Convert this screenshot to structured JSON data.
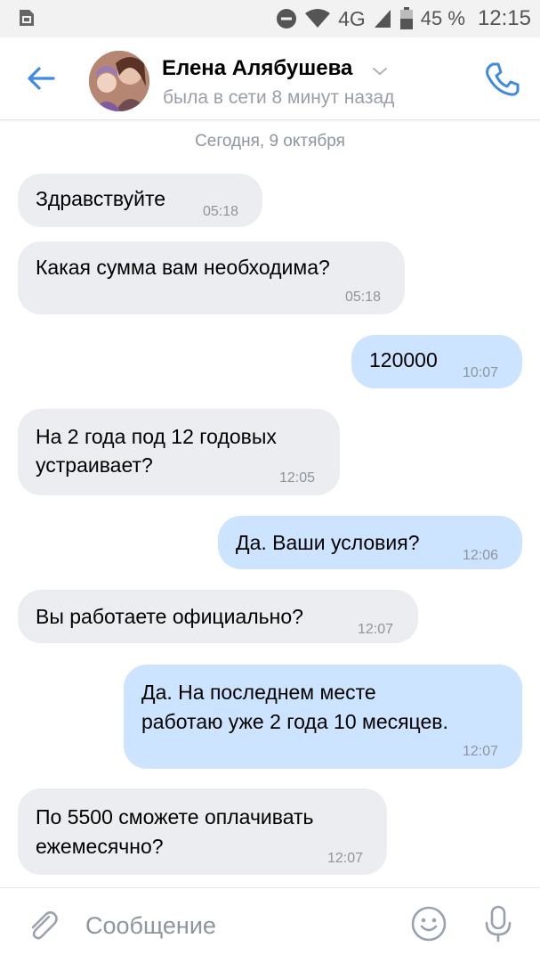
{
  "status_bar": {
    "network": "4G",
    "battery": "45 %",
    "time": "12:15",
    "icons": [
      "sim-card-icon",
      "do-not-disturb-icon",
      "wifi-icon",
      "signal-icon",
      "battery-icon"
    ]
  },
  "header": {
    "name": "Елена Алябушева",
    "status": "была в сети 8 минут назад",
    "icons": [
      "back-arrow-icon",
      "chevron-down-icon",
      "phone-icon"
    ],
    "accent_color": "#3f8ae0"
  },
  "chat": {
    "date": "Сегодня, 9 октября",
    "colors": {
      "incoming": "#ebedf0",
      "outgoing": "#cce4ff",
      "time": "#8e959b"
    },
    "messages": [
      {
        "dir": "in",
        "lines": [
          "Здравствуйте"
        ],
        "time": "05:18"
      },
      {
        "dir": "in",
        "lines": [
          "Какая сумма вам необходима?"
        ],
        "time": "05:18"
      },
      {
        "dir": "out",
        "lines": [
          "120000"
        ],
        "time": "10:07"
      },
      {
        "dir": "in",
        "lines": [
          "На 2 года под 12 годовых",
          "устраивает?"
        ],
        "time": "12:05"
      },
      {
        "dir": "out",
        "lines": [
          "Да. Ваши условия?"
        ],
        "time": "12:06"
      },
      {
        "dir": "in",
        "lines": [
          "Вы работаете официально?"
        ],
        "time": "12:07"
      },
      {
        "dir": "out",
        "lines": [
          "Да. На последнем месте",
          "работаю уже 2 года 10 месяцев."
        ],
        "time": "12:07"
      },
      {
        "dir": "in",
        "lines": [
          "По 5500 сможете оплачивать",
          "ежемесячно?"
        ],
        "time": "12:07"
      }
    ]
  },
  "composer": {
    "placeholder": "Сообщение",
    "icons": [
      "paperclip-icon",
      "emoji-icon",
      "microphone-icon"
    ]
  }
}
